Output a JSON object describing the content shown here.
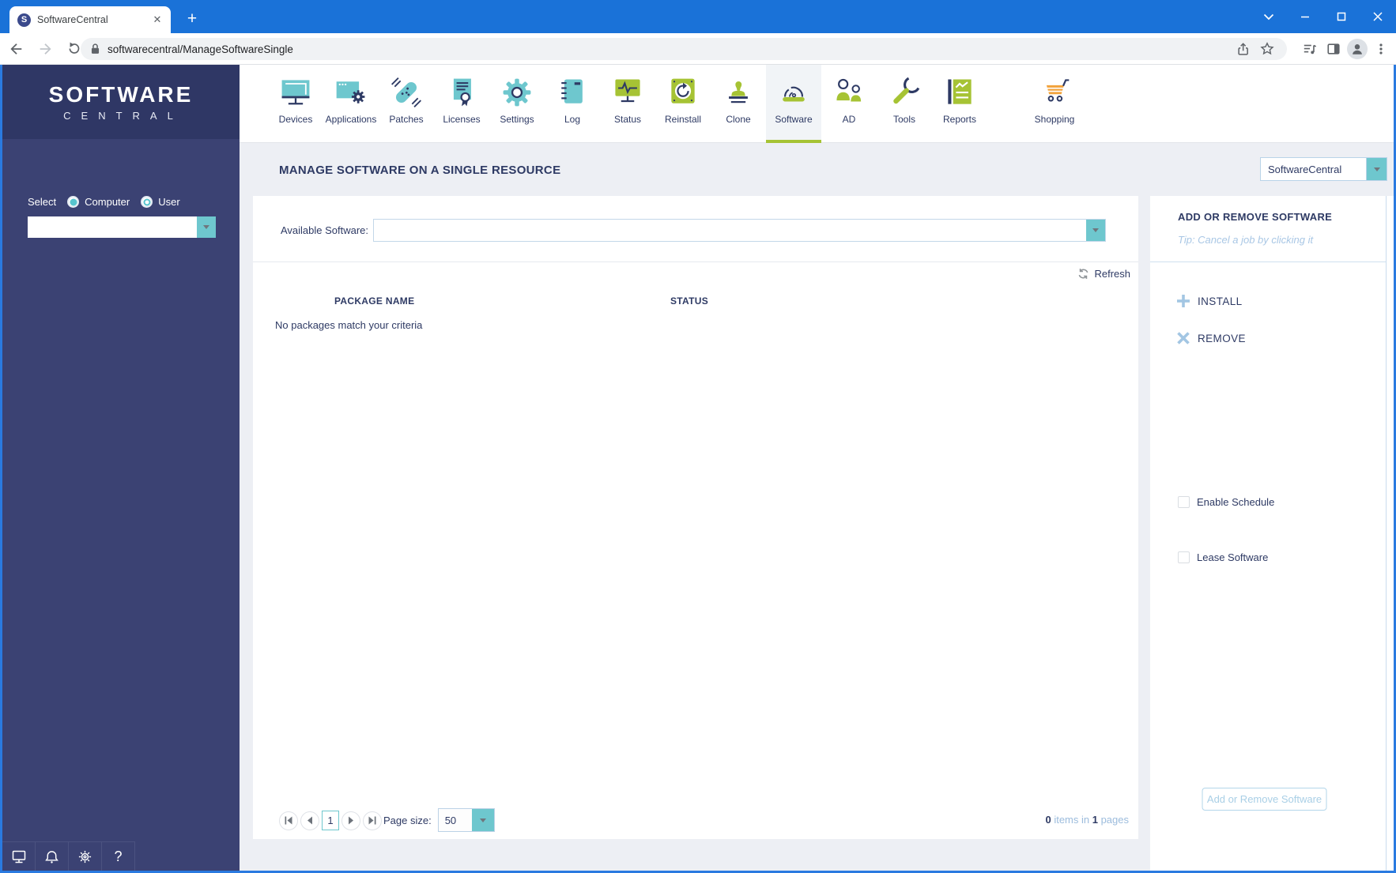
{
  "browser": {
    "tab_title": "SoftwareCentral",
    "url": "softwarecentral/ManageSoftwareSingle",
    "new_tab_label": "+"
  },
  "logo": {
    "line1": "SOFTWARE",
    "line2": "CENTRAL"
  },
  "sidebar": {
    "select_label": "Select",
    "radio_computer_label": "Computer",
    "radio_user_label": "User",
    "resource_value": ""
  },
  "nav": {
    "selected": "Software",
    "items": [
      {
        "label": "Devices",
        "icon": "devices-icon"
      },
      {
        "label": "Applications",
        "icon": "applications-icon"
      },
      {
        "label": "Patches",
        "icon": "patches-icon"
      },
      {
        "label": "Licenses",
        "icon": "licenses-icon"
      },
      {
        "label": "Settings",
        "icon": "settings-icon"
      },
      {
        "label": "Log",
        "icon": "log-icon"
      },
      {
        "label": "Status",
        "icon": "status-icon"
      },
      {
        "label": "Reinstall",
        "icon": "reinstall-icon"
      },
      {
        "label": "Clone",
        "icon": "clone-icon"
      },
      {
        "label": "Software",
        "icon": "software-icon"
      },
      {
        "label": "AD",
        "icon": "ad-icon"
      },
      {
        "label": "Tools",
        "icon": "tools-icon"
      },
      {
        "label": "Reports",
        "icon": "reports-icon"
      },
      {
        "label": "Shopping",
        "icon": "shopping-icon"
      }
    ]
  },
  "header": {
    "title": "MANAGE SOFTWARE ON A SINGLE RESOURCE",
    "context_dropdown_value": "SoftwareCentral"
  },
  "main": {
    "available_software_label": "Available Software:",
    "available_software_value": "",
    "refresh_label": "Refresh",
    "table": {
      "columns": [
        "PACKAGE NAME",
        "STATUS"
      ],
      "rows": [],
      "empty_message": "No packages match your criteria"
    },
    "pagination": {
      "current_page": "1",
      "page_size_label": "Page size:",
      "page_size_value": "50",
      "summary_count": "0",
      "summary_items_text": " items in ",
      "summary_pages": "1",
      "summary_pages_text": " pages"
    }
  },
  "panel": {
    "title": "ADD OR REMOVE SOFTWARE",
    "tip": "Tip: Cancel a job by clicking it",
    "install_label": "INSTALL",
    "remove_label": "REMOVE",
    "enable_schedule_label": "Enable Schedule",
    "lease_software_label": "Lease Software",
    "submit_label": "Add or Remove Software"
  },
  "colors": {
    "chrome_blue": "#1a72d8",
    "sidebar_navy": "#3b4273",
    "icon_navy": "#2e3a64",
    "teal_accent": "#6ec7ce",
    "green_accent": "#a6c334",
    "orange_accent": "#f2a33c",
    "disabled_blue": "#a9cfe6",
    "page_background": "#edeff4"
  }
}
